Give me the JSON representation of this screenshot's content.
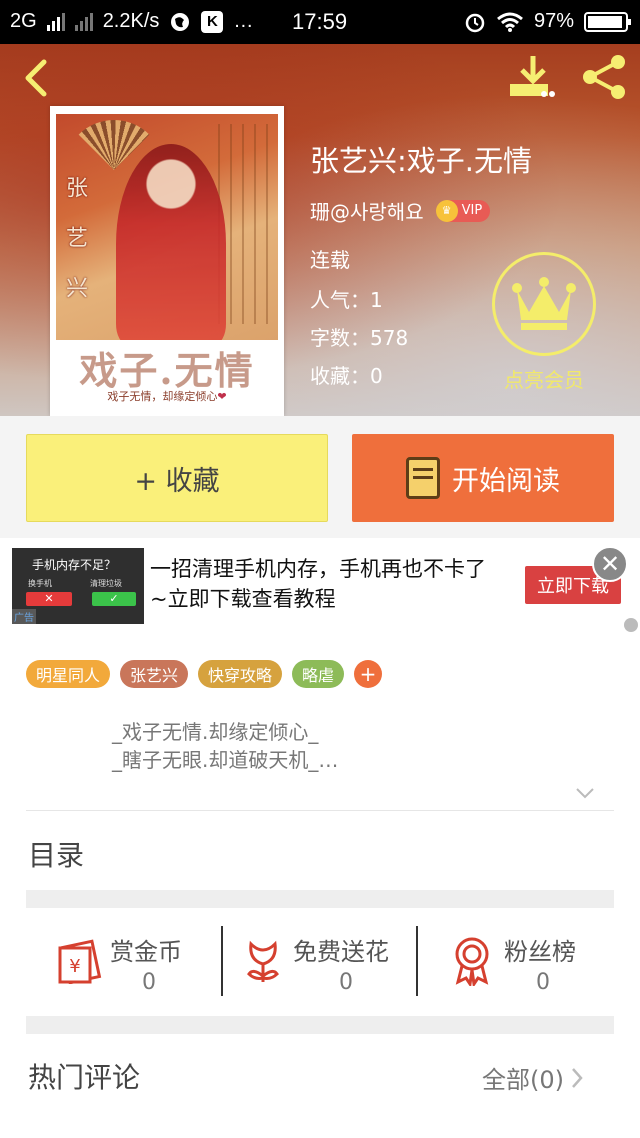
{
  "status_bar": {
    "network": "2G",
    "speed": "2.2K/s",
    "more": "…",
    "app_icon_letter": "K",
    "time": "17:59",
    "battery": "97%",
    "icons": [
      "signal-icon",
      "globe-icon",
      "alarm-icon",
      "wifi-icon",
      "battery-icon"
    ]
  },
  "header": {
    "icons": [
      "back-icon",
      "download-icon",
      "share-icon"
    ],
    "book_title": "张艺兴:戏子.无情",
    "author": "珊@사랑해요",
    "vip_label": "VIP",
    "status": "连载",
    "popularity": "人气：1",
    "word_count": "字数：578",
    "favorites": "收藏：0",
    "member_label": "点亮会员"
  },
  "cover": {
    "vertical_text": "张艺兴",
    "title": "戏子.无情",
    "subtitle": "戏子无情，却缘定倾心",
    "heart": "❤"
  },
  "actions": {
    "favorite_label": "+ 收藏",
    "read_label": "开始阅读"
  },
  "ad": {
    "thumb_question": "手机内存不足？",
    "thumb_btn_left": "换手机",
    "thumb_btn_right": "清理垃圾",
    "thumb_tag": "广告",
    "text": "一招清理手机内存，手机再也不卡了~立即下载查看教程",
    "cta": "立即下载",
    "close": "✕"
  },
  "tags": [
    {
      "label": "明星同人",
      "color": "#f2a93b"
    },
    {
      "label": "张艺兴",
      "color": "#c9765a"
    },
    {
      "label": "快穿攻略",
      "color": "#d6a23e"
    },
    {
      "label": "略虐",
      "color": "#8dbb58"
    }
  ],
  "tag_add": "+",
  "summary": {
    "line1": "_戏子无情.却缘定倾心_",
    "line2": "_瞎子无眼.却道破天机_…"
  },
  "toc_title": "目录",
  "stats": [
    {
      "label": "赏金币",
      "value": "0",
      "icon": "red-envelope-icon"
    },
    {
      "label": "免费送花",
      "value": "0",
      "icon": "flower-icon"
    },
    {
      "label": "粉丝榜",
      "value": "0",
      "icon": "medal-icon"
    }
  ],
  "comments": {
    "title": "热门评论",
    "all_label": "全部(0)"
  },
  "colors": {
    "accent_orange": "#ef6f3c",
    "favorite_yellow": "#faf07a",
    "member_yellow": "#f4ed6a"
  }
}
